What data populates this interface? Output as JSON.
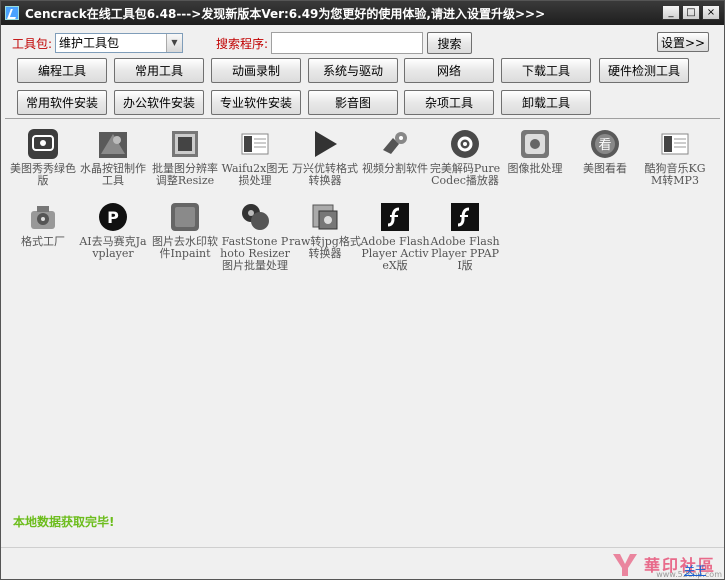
{
  "titlebar": {
    "title": "Cencrack在线工具包6.48--->发现新版本Ver:6.49为您更好的使用体验,请进入设置升级>>>",
    "min": "_",
    "max": "□",
    "close": "×"
  },
  "toolbar": {
    "pkg_label": "工具包:",
    "pkg_selected": "维护工具包",
    "pkg_arrow": "▼",
    "search_label": "搜索程序:",
    "search_value": "",
    "search_button": "搜索",
    "settings_button": "设置>>"
  },
  "categories": {
    "row1": [
      "编程工具",
      "常用工具",
      "动画录制",
      "系统与驱动",
      "网络",
      "下载工具",
      "硬件检测工具"
    ],
    "row2": [
      "常用软件安装",
      "办公软件安装",
      "专业软件安装",
      "影音图",
      "杂项工具",
      "卸载工具"
    ]
  },
  "tools": [
    {
      "name": "美图秀秀绿色版",
      "icon": "meitu-icon"
    },
    {
      "name": "水晶按钮制作工具",
      "icon": "crystal-button-icon"
    },
    {
      "name": "批量图分辨率调整Resize",
      "icon": "batch-resize-icon"
    },
    {
      "name": "Waifu2x图无损处理",
      "icon": "waifu2x-icon"
    },
    {
      "name": "万兴优转格式转换器",
      "icon": "play-icon"
    },
    {
      "name": "视频分割软件",
      "icon": "video-split-icon"
    },
    {
      "name": "完美解码PureCodec播放器",
      "icon": "purecodec-icon"
    },
    {
      "name": "图像批处理",
      "icon": "image-batch-icon"
    },
    {
      "name": "美图看看",
      "icon": "kankan-icon"
    },
    {
      "name": "酷狗音乐KGM转MP3",
      "icon": "kgm-icon"
    },
    {
      "name": "格式工厂",
      "icon": "format-factory-icon"
    },
    {
      "name": "AI去马赛克Javplayer",
      "icon": "javplayer-icon"
    },
    {
      "name": "图片去水印软件Inpaint",
      "icon": "inpaint-icon"
    },
    {
      "name": "FastStone Photo Resizer图片批量处理",
      "icon": "faststone-icon"
    },
    {
      "name": "raw转jpg格式转换器",
      "icon": "raw-convert-icon"
    },
    {
      "name": "Adobe Flash Player ActiveX版",
      "icon": "flash-activex-icon"
    },
    {
      "name": "Adobe Flash Player PPAPI版",
      "icon": "flash-ppapi-icon"
    }
  ],
  "status": "本地数据获取完毕!",
  "footer": {
    "watermark": "華印社區",
    "url": "www.52cnp.com",
    "about": "关于"
  }
}
